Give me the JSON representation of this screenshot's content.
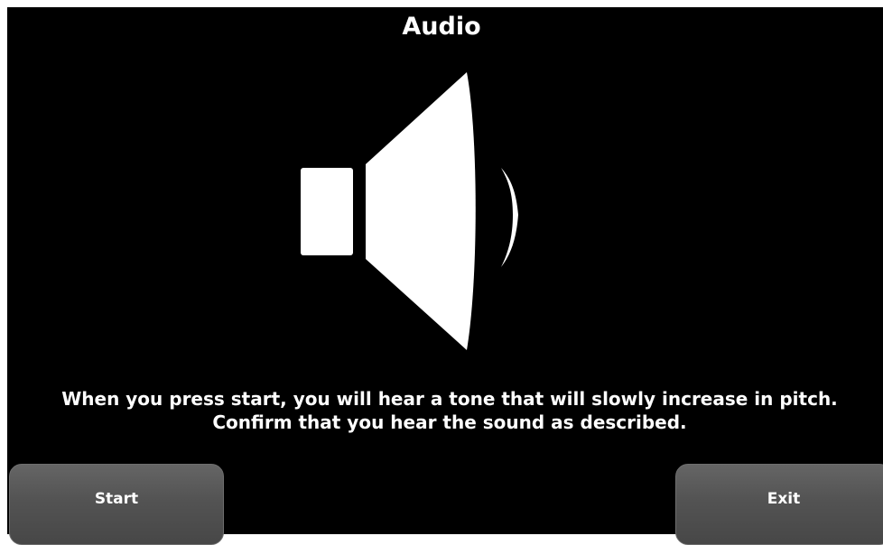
{
  "screen": {
    "title": "Audio",
    "icon": "speaker-icon",
    "instructions": {
      "line1": "When you press start, you will hear a tone that will slowly increase in pitch.",
      "line2": "Confirm that you hear the sound as described."
    }
  },
  "buttons": {
    "start_label": "Start",
    "exit_label": "Exit"
  },
  "colors": {
    "background": "#000000",
    "foreground": "#ffffff",
    "button": "#535353"
  }
}
